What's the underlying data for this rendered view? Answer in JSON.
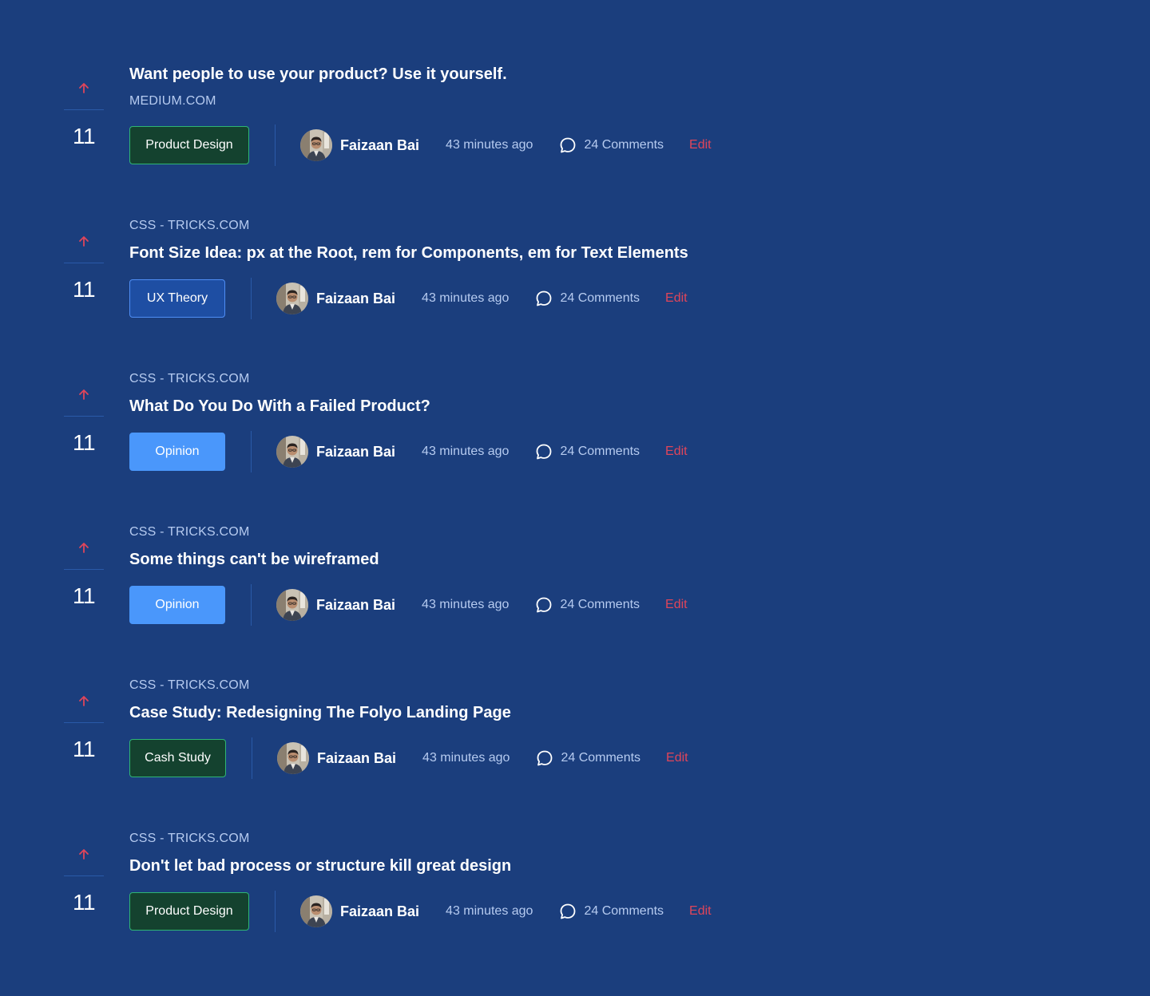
{
  "colors": {
    "background": "#1b3e7d",
    "upvote_arrow": "#e0455a",
    "edit_link": "#e0455a",
    "muted_text": "#b6cbf0"
  },
  "posts": [
    {
      "source": "MEDIUM.COM",
      "title": "Want people to use your product? Use it yourself.",
      "votes": "11",
      "tag": "Product Design",
      "author": "Faizaan Bai",
      "time": "43 minutes ago",
      "comments": "24 Comments",
      "edit": "Edit"
    },
    {
      "source": "CSS - TRICKS.COM",
      "title": "Font Size Idea: px at the Root, rem for Components, em for Text Elements",
      "votes": "11",
      "tag": "UX Theory",
      "author": "Faizaan Bai",
      "time": "43 minutes ago",
      "comments": "24 Comments",
      "edit": "Edit"
    },
    {
      "source": "CSS - TRICKS.COM",
      "title": "What Do You Do With a Failed Product?",
      "votes": "11",
      "tag": "Opinion",
      "author": "Faizaan Bai",
      "time": "43 minutes ago",
      "comments": "24 Comments",
      "edit": "Edit"
    },
    {
      "source": "CSS - TRICKS.COM",
      "title": "Some things can't be wireframed",
      "votes": "11",
      "tag": "Opinion",
      "author": "Faizaan Bai",
      "time": "43 minutes ago",
      "comments": "24 Comments",
      "edit": "Edit"
    },
    {
      "source": "CSS - TRICKS.COM",
      "title": "Case Study: Redesigning The Folyo Landing Page",
      "votes": "11",
      "tag": "Cash Study",
      "author": "Faizaan Bai",
      "time": "43 minutes ago",
      "comments": "24 Comments",
      "edit": "Edit"
    },
    {
      "source": "CSS - TRICKS.COM",
      "title": "Don't let bad process or structure kill great design",
      "votes": "11",
      "tag": "Product Design",
      "author": "Faizaan Bai",
      "time": "43 minutes ago",
      "comments": "24 Comments",
      "edit": "Edit"
    }
  ]
}
